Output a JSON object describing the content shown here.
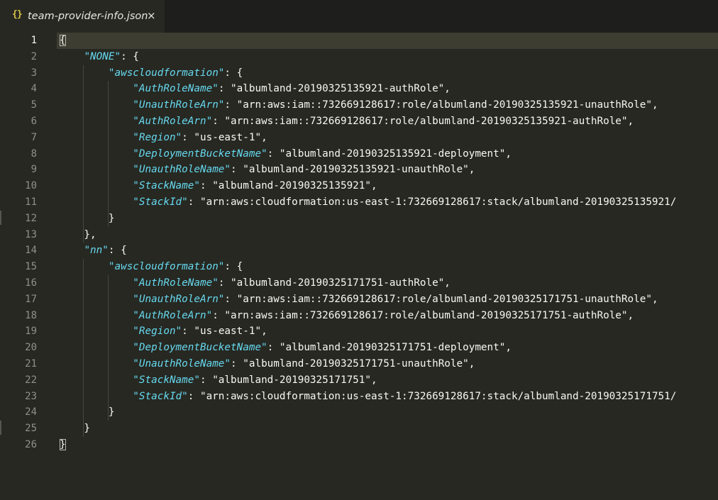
{
  "tab": {
    "icon": "json-braces-icon",
    "icon_text": "{}",
    "title": "team-provider-info.json",
    "close_glyph": "×"
  },
  "editor": {
    "current_line": 1,
    "lines": [
      {
        "n": "1",
        "tokens": [
          {
            "t": "p",
            "v": "{"
          }
        ]
      },
      {
        "n": "2",
        "tokens": [
          {
            "t": "p",
            "v": "    "
          },
          {
            "t": "k",
            "v": "\"NONE\""
          },
          {
            "t": "p",
            "v": ": {"
          }
        ]
      },
      {
        "n": "3",
        "tokens": [
          {
            "t": "p",
            "v": "        "
          },
          {
            "t": "k",
            "v": "\"awscloudformation\""
          },
          {
            "t": "p",
            "v": ": {"
          }
        ]
      },
      {
        "n": "4",
        "tokens": [
          {
            "t": "p",
            "v": "            "
          },
          {
            "t": "k",
            "v": "\"AuthRoleName\""
          },
          {
            "t": "p",
            "v": ": "
          },
          {
            "t": "str",
            "v": "\"albumland-20190325135921-authRole\""
          },
          {
            "t": "p",
            "v": ","
          }
        ]
      },
      {
        "n": "5",
        "tokens": [
          {
            "t": "p",
            "v": "            "
          },
          {
            "t": "k",
            "v": "\"UnauthRoleArn\""
          },
          {
            "t": "p",
            "v": ": "
          },
          {
            "t": "str",
            "v": "\"arn:aws:iam::732669128617:role/albumland-20190325135921-unauthRole\""
          },
          {
            "t": "p",
            "v": ","
          }
        ]
      },
      {
        "n": "6",
        "tokens": [
          {
            "t": "p",
            "v": "            "
          },
          {
            "t": "k",
            "v": "\"AuthRoleArn\""
          },
          {
            "t": "p",
            "v": ": "
          },
          {
            "t": "str",
            "v": "\"arn:aws:iam::732669128617:role/albumland-20190325135921-authRole\""
          },
          {
            "t": "p",
            "v": ","
          }
        ]
      },
      {
        "n": "7",
        "tokens": [
          {
            "t": "p",
            "v": "            "
          },
          {
            "t": "k",
            "v": "\"Region\""
          },
          {
            "t": "p",
            "v": ": "
          },
          {
            "t": "str",
            "v": "\"us-east-1\""
          },
          {
            "t": "p",
            "v": ","
          }
        ]
      },
      {
        "n": "8",
        "tokens": [
          {
            "t": "p",
            "v": "            "
          },
          {
            "t": "k",
            "v": "\"DeploymentBucketName\""
          },
          {
            "t": "p",
            "v": ": "
          },
          {
            "t": "str",
            "v": "\"albumland-20190325135921-deployment\""
          },
          {
            "t": "p",
            "v": ","
          }
        ]
      },
      {
        "n": "9",
        "tokens": [
          {
            "t": "p",
            "v": "            "
          },
          {
            "t": "k",
            "v": "\"UnauthRoleName\""
          },
          {
            "t": "p",
            "v": ": "
          },
          {
            "t": "str",
            "v": "\"albumland-20190325135921-unauthRole\""
          },
          {
            "t": "p",
            "v": ","
          }
        ]
      },
      {
        "n": "10",
        "tokens": [
          {
            "t": "p",
            "v": "            "
          },
          {
            "t": "k",
            "v": "\"StackName\""
          },
          {
            "t": "p",
            "v": ": "
          },
          {
            "t": "str",
            "v": "\"albumland-20190325135921\""
          },
          {
            "t": "p",
            "v": ","
          }
        ]
      },
      {
        "n": "11",
        "tokens": [
          {
            "t": "p",
            "v": "            "
          },
          {
            "t": "k",
            "v": "\"StackId\""
          },
          {
            "t": "p",
            "v": ": "
          },
          {
            "t": "str",
            "v": "\"arn:aws:cloudformation:us-east-1:732669128617:stack/albumland-20190325135921/"
          }
        ]
      },
      {
        "n": "12",
        "tokens": [
          {
            "t": "p",
            "v": "        }"
          }
        ]
      },
      {
        "n": "13",
        "tokens": [
          {
            "t": "p",
            "v": "    },"
          }
        ]
      },
      {
        "n": "14",
        "tokens": [
          {
            "t": "p",
            "v": "    "
          },
          {
            "t": "k",
            "v": "\"nn\""
          },
          {
            "t": "p",
            "v": ": {"
          }
        ]
      },
      {
        "n": "15",
        "tokens": [
          {
            "t": "p",
            "v": "        "
          },
          {
            "t": "k",
            "v": "\"awscloudformation\""
          },
          {
            "t": "p",
            "v": ": {"
          }
        ]
      },
      {
        "n": "16",
        "tokens": [
          {
            "t": "p",
            "v": "            "
          },
          {
            "t": "k",
            "v": "\"AuthRoleName\""
          },
          {
            "t": "p",
            "v": ": "
          },
          {
            "t": "str",
            "v": "\"albumland-20190325171751-authRole\""
          },
          {
            "t": "p",
            "v": ","
          }
        ]
      },
      {
        "n": "17",
        "tokens": [
          {
            "t": "p",
            "v": "            "
          },
          {
            "t": "k",
            "v": "\"UnauthRoleArn\""
          },
          {
            "t": "p",
            "v": ": "
          },
          {
            "t": "str",
            "v": "\"arn:aws:iam::732669128617:role/albumland-20190325171751-unauthRole\""
          },
          {
            "t": "p",
            "v": ","
          }
        ]
      },
      {
        "n": "18",
        "tokens": [
          {
            "t": "p",
            "v": "            "
          },
          {
            "t": "k",
            "v": "\"AuthRoleArn\""
          },
          {
            "t": "p",
            "v": ": "
          },
          {
            "t": "str",
            "v": "\"arn:aws:iam::732669128617:role/albumland-20190325171751-authRole\""
          },
          {
            "t": "p",
            "v": ","
          }
        ]
      },
      {
        "n": "19",
        "tokens": [
          {
            "t": "p",
            "v": "            "
          },
          {
            "t": "k",
            "v": "\"Region\""
          },
          {
            "t": "p",
            "v": ": "
          },
          {
            "t": "str",
            "v": "\"us-east-1\""
          },
          {
            "t": "p",
            "v": ","
          }
        ]
      },
      {
        "n": "20",
        "tokens": [
          {
            "t": "p",
            "v": "            "
          },
          {
            "t": "k",
            "v": "\"DeploymentBucketName\""
          },
          {
            "t": "p",
            "v": ": "
          },
          {
            "t": "str",
            "v": "\"albumland-20190325171751-deployment\""
          },
          {
            "t": "p",
            "v": ","
          }
        ]
      },
      {
        "n": "21",
        "tokens": [
          {
            "t": "p",
            "v": "            "
          },
          {
            "t": "k",
            "v": "\"UnauthRoleName\""
          },
          {
            "t": "p",
            "v": ": "
          },
          {
            "t": "str",
            "v": "\"albumland-20190325171751-unauthRole\""
          },
          {
            "t": "p",
            "v": ","
          }
        ]
      },
      {
        "n": "22",
        "tokens": [
          {
            "t": "p",
            "v": "            "
          },
          {
            "t": "k",
            "v": "\"StackName\""
          },
          {
            "t": "p",
            "v": ": "
          },
          {
            "t": "str",
            "v": "\"albumland-20190325171751\""
          },
          {
            "t": "p",
            "v": ","
          }
        ]
      },
      {
        "n": "23",
        "tokens": [
          {
            "t": "p",
            "v": "            "
          },
          {
            "t": "k",
            "v": "\"StackId\""
          },
          {
            "t": "p",
            "v": ": "
          },
          {
            "t": "str",
            "v": "\"arn:aws:cloudformation:us-east-1:732669128617:stack/albumland-20190325171751/"
          }
        ]
      },
      {
        "n": "24",
        "tokens": [
          {
            "t": "p",
            "v": "        }"
          }
        ]
      },
      {
        "n": "25",
        "tokens": [
          {
            "t": "p",
            "v": "    }"
          }
        ]
      },
      {
        "n": "26",
        "tokens": [
          {
            "t": "p",
            "v": "}"
          }
        ]
      }
    ]
  },
  "colors": {
    "background": "#272822",
    "tabbar": "#1e1f1c",
    "key": "#66d9ef",
    "text": "#f8f8f2",
    "line_number": "#90908a",
    "current_line": "#3e3d32",
    "icon": "#d8c34a"
  }
}
